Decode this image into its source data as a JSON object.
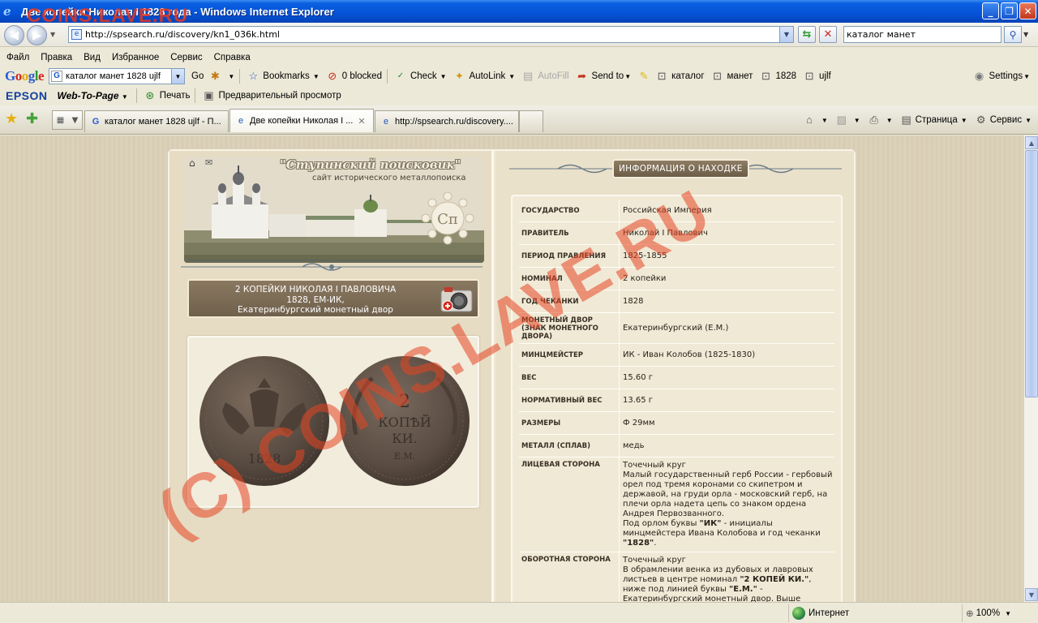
{
  "window": {
    "title": "Две копейки Николая I 1828 года - Windows Internet Explorer"
  },
  "address_bar": {
    "url": "http://spsearch.ru/discovery/kn1_036k.html",
    "search_value": "каталог манет"
  },
  "menu": [
    "Файл",
    "Правка",
    "Вид",
    "Избранное",
    "Сервис",
    "Справка"
  ],
  "google_toolbar": {
    "logo": "Google",
    "search_value": "каталог манет 1828 ujlf",
    "go_label": "Go",
    "bookmarks_label": "Bookmarks",
    "blocked_label": "0 blocked",
    "check_label": "Check",
    "autolink_label": "AutoLink",
    "autofill_label": "AutoFill",
    "sendto_label": "Send to",
    "highlight_terms": [
      "каталог",
      "манет",
      "1828",
      "ujlf"
    ],
    "settings_label": "Settings"
  },
  "epson_toolbar": {
    "logo": "EPSON",
    "web_to_page": "Web-To-Page",
    "print_label": "Печать",
    "preview_label": "Предварительный просмотр"
  },
  "tabs": [
    {
      "label": "каталог манет 1828 ujlf - П...",
      "icon": "google-icon",
      "active": false
    },
    {
      "label": "Две копейки Николая I ...",
      "icon": "ie-page-icon",
      "active": true
    },
    {
      "label": "http://spsearch.ru/discovery....",
      "icon": "ie-page-icon",
      "active": false
    }
  ],
  "command_bar": {
    "page_label": "Страница",
    "tools_label": "Сервис"
  },
  "site": {
    "title": "\"Ступинский поисковик\"",
    "subtitle": "сайт исторического металлопоиска",
    "emblem_text": "Сп"
  },
  "coin": {
    "title_line1": "2 КОПЕЙКИ НИКОЛАЯ I ПАВЛОВИЧА",
    "title_line2": "1828, ЕМ-ИК,",
    "title_line3": "Екатеринбургский монетный двор",
    "reverse_text_1": "2",
    "reverse_text_2": "КОПѢЙ",
    "reverse_text_3": "КИ.",
    "reverse_text_4": "Е.М.",
    "obverse_date": "1828"
  },
  "info": {
    "header": "ИНФОРМАЦИЯ О НАХОДКЕ",
    "rows": [
      {
        "k": "ГОСУДАРСТВО",
        "v": "Российская Империя"
      },
      {
        "k": "ПРАВИТЕЛЬ",
        "v": "Николай I Павлович"
      },
      {
        "k": "ПЕРИОД ПРАВЛЕНИЯ",
        "v": "1825-1855"
      },
      {
        "k": "НОМИНАЛ",
        "v": "2 копейки"
      },
      {
        "k": "ГОД ЧЕКАНКИ",
        "v": "1828"
      },
      {
        "k": "МОНЕТНЫЙ ДВОР (ЗНАК МОНЕТНОГО ДВОРА)",
        "v": "Екатеринбургский (Е.М.)"
      },
      {
        "k": "МИНЦМЕЙСТЕР",
        "v": "ИК - Иван Колобов (1825-1830)"
      },
      {
        "k": "ВЕС",
        "v": "15.60 г"
      },
      {
        "k": "НОРМАТИВНЫЙ ВЕС",
        "v": "13.65 г"
      },
      {
        "k": "РАЗМЕРЫ",
        "v": "Ф 29мм"
      },
      {
        "k": "МЕТАЛЛ (СПЛАВ)",
        "v": "медь"
      }
    ],
    "obverse_key": "ЛИЦЕВАЯ СТОРОНА",
    "obverse_1": "Точечный круг",
    "obverse_2": "Малый государственный герб России - гербовый орел под тремя коронами со скипетром и державой, на груди орла - московский герб, на плечи орла надета цепь со знаком ордена Андрея Первозванного.",
    "obverse_3a": "Под орлом буквы ",
    "obverse_3b": "\"ИК\"",
    "obverse_3c": " - инициалы минцмейстера Ивана Колобова и год чеканки ",
    "obverse_3d": "\"1828\"",
    "obverse_3e": ".",
    "reverse_key": "ОБОРОТНАЯ СТОРОНА",
    "reverse_1": "Точечный круг",
    "reverse_2a": "В обрамлении венка из дубовых и лавровых листьев в центре номинал ",
    "reverse_2b": "\"2 КОПЕЙ КИ.\"",
    "reverse_2c": ", ниже под линией буквы ",
    "reverse_2d": "\"Е.М.\"",
    "reverse_2e": " - Екатеринбургский монетный двор. Выше номинала императорская корона."
  },
  "status_bar": {
    "zone": "Интернет",
    "zoom": "100%"
  },
  "watermark": {
    "top": "COINS.LAVE.RU",
    "diagonal": "(C) COINS.LAVE.RU"
  },
  "colors": {
    "titlebar": "#0553d8",
    "chrome": "#ece9d8",
    "watermark": "#e64623",
    "panel_brown": "#7a6a54"
  }
}
